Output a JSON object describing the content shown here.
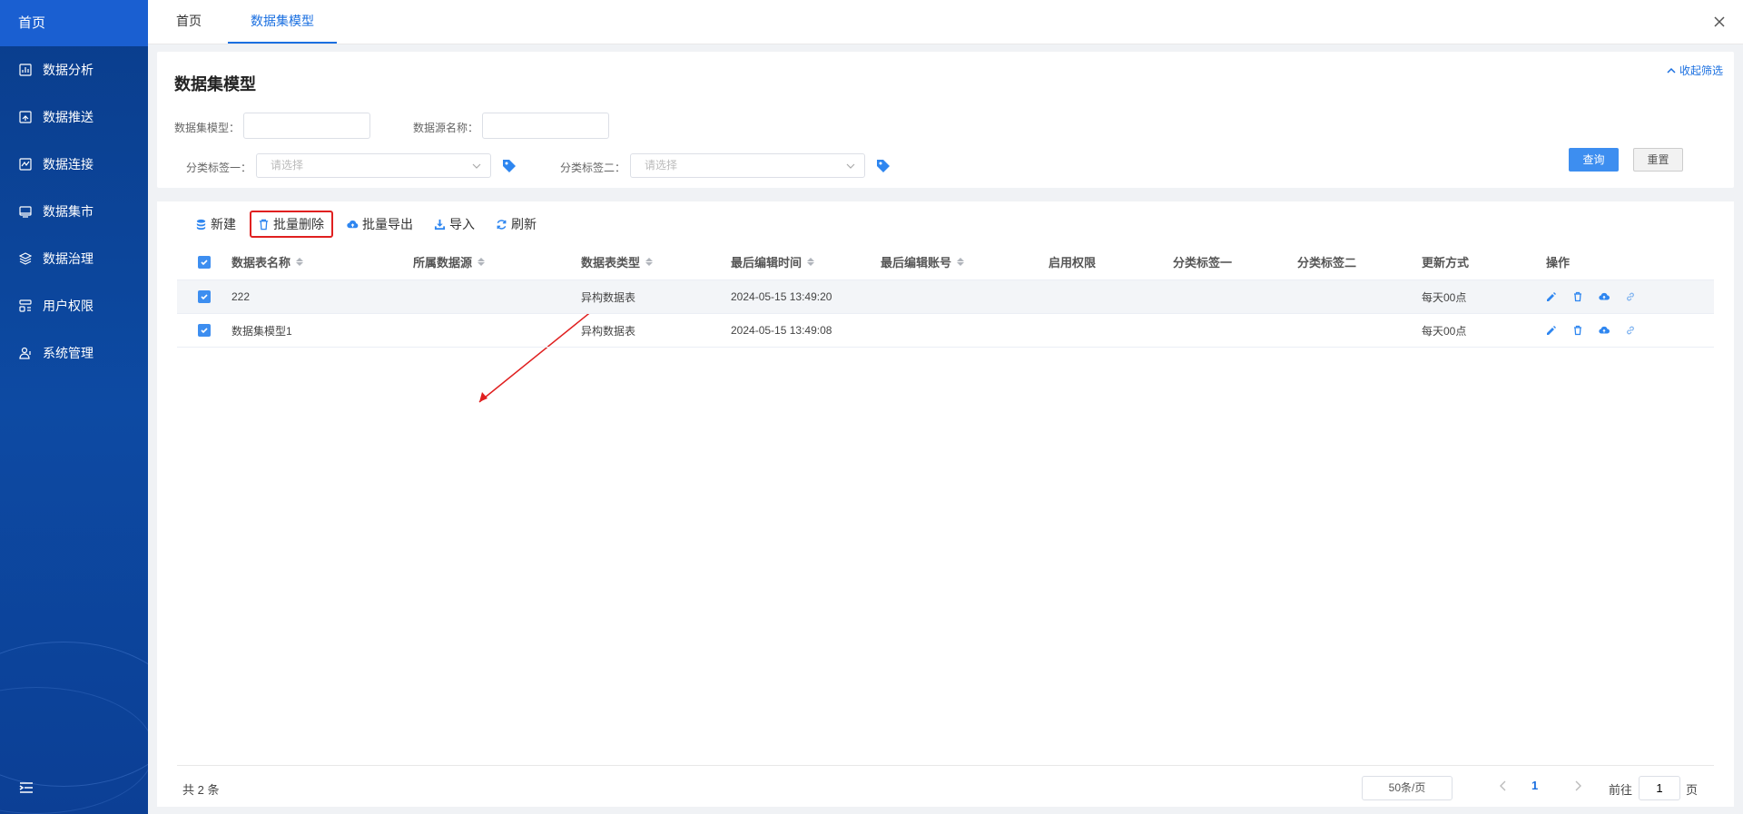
{
  "sidebar": {
    "home": "首页",
    "items": [
      {
        "label": "数据分析",
        "icon": "chart-icon"
      },
      {
        "label": "数据推送",
        "icon": "push-icon"
      },
      {
        "label": "数据连接",
        "icon": "connect-icon"
      },
      {
        "label": "数据集市",
        "icon": "monitor-icon"
      },
      {
        "label": "数据治理",
        "icon": "layers-icon"
      },
      {
        "label": "用户权限",
        "icon": "user-permission-icon"
      },
      {
        "label": "系统管理",
        "icon": "system-user-icon"
      }
    ]
  },
  "tabs": {
    "home": "首页",
    "active": "数据集模型"
  },
  "filter": {
    "title": "数据集模型",
    "collapse_label": "收起筛选",
    "dataset_label": "数据集模型：",
    "dataset_value": "",
    "source_label": "数据源名称：",
    "source_value": "",
    "tag1_label": "分类标签一：",
    "tag1_placeholder": "请选择",
    "tag2_label": "分类标签二：",
    "tag2_placeholder": "请选择",
    "query_btn": "查询",
    "reset_btn": "重置"
  },
  "toolbar": {
    "new": "新建",
    "batch_delete": "批量删除",
    "batch_export": "批量导出",
    "import": "导入",
    "refresh": "刷新"
  },
  "table": {
    "headers": {
      "name": "数据表名称",
      "source": "所属数据源",
      "type": "数据表类型",
      "time": "最后编辑时间",
      "account": "最后编辑账号",
      "permission": "启用权限",
      "tag1": "分类标签一",
      "tag2": "分类标签二",
      "update": "更新方式",
      "ops": "操作"
    },
    "rows": [
      {
        "name": "222",
        "source": "",
        "type": "异构数据表",
        "time": "2024-05-15 13:49:20",
        "account": "",
        "permission": "",
        "tag1": "",
        "tag2": "",
        "update": "每天00点"
      },
      {
        "name": "数据集模型1",
        "source": "",
        "type": "异构数据表",
        "time": "2024-05-15 13:49:08",
        "account": "",
        "permission": "",
        "tag1": "",
        "tag2": "",
        "update": "每天00点"
      }
    ]
  },
  "footer": {
    "total": "共 2 条",
    "page_size": "50条/页",
    "current_page": "1",
    "goto_label": "前往",
    "goto_value": "1",
    "goto_unit": "页"
  },
  "colors": {
    "accent": "#1a6fe0",
    "sidebar_bg": "#0d4aa3",
    "highlight_box": "#e02020"
  }
}
